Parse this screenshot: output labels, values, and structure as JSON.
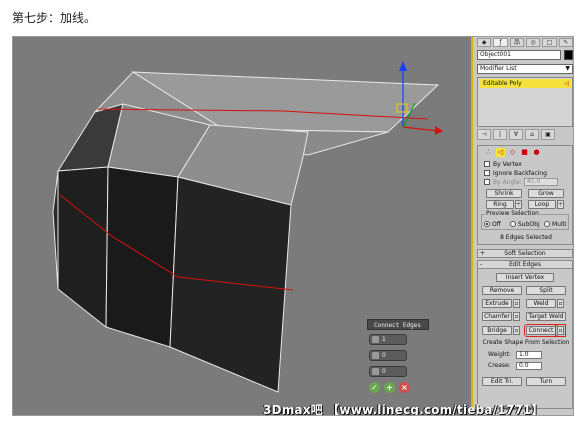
{
  "caption": "第七步：加线。",
  "watermark": "3Dmax吧 【www.linecg.com/tieba/1771】",
  "panel": {
    "tabs": [
      "◆",
      "ƒ",
      "品",
      "◎",
      "□",
      "✎"
    ],
    "object_name": "Object001",
    "modifier_list": "Modifier List",
    "stack_item": "Editable Poly",
    "stack_tools": [
      "⊣",
      "|",
      "∀",
      "⌂",
      "▣"
    ],
    "selection": {
      "icons": [
        "∴",
        "◁",
        "◇",
        "■",
        "●"
      ],
      "by_vertex": "By Vertex",
      "ignore_backfacing": "Ignore Backfacing",
      "by_angle": "By Angle:",
      "angle_value": "45.0",
      "shrink": "Shrink",
      "grow": "Grow",
      "ring": "Ring",
      "loop": "Loop",
      "preview_title": "Preview Selection",
      "preview_off": "Off",
      "preview_subobj": "SubObj",
      "preview_multi": "Multi",
      "status": "8 Edges Selected"
    },
    "soft_selection": "Soft Selection",
    "edit_edges": {
      "title": "Edit Edges",
      "insert_vertex": "Insert Vertex",
      "remove": "Remove",
      "split": "Split",
      "extrude": "Extrude",
      "weld": "Weld",
      "chamfer": "Chamfer",
      "target_weld": "Target Weld",
      "bridge": "Bridge",
      "connect": "Connect",
      "create_shape": "Create Shape From Selection",
      "weight_label": "Weight:",
      "weight_value": "1.0",
      "crease_label": "Crease:",
      "crease_value": "0.0",
      "edit_tri": "Edit Tri.",
      "turn": "Turn",
      "repeat_last": "Repeat Last"
    }
  },
  "caddy": {
    "title": "Connect Edges",
    "segments": "1",
    "pinch": "0",
    "slide": "0",
    "ok": "✓",
    "apply": "+",
    "cancel": "×"
  },
  "colors": {
    "accent": "#f5e23c",
    "highlight": "#e02020",
    "viewport": "#7b7b7b",
    "selected_edge": "#d81010"
  }
}
